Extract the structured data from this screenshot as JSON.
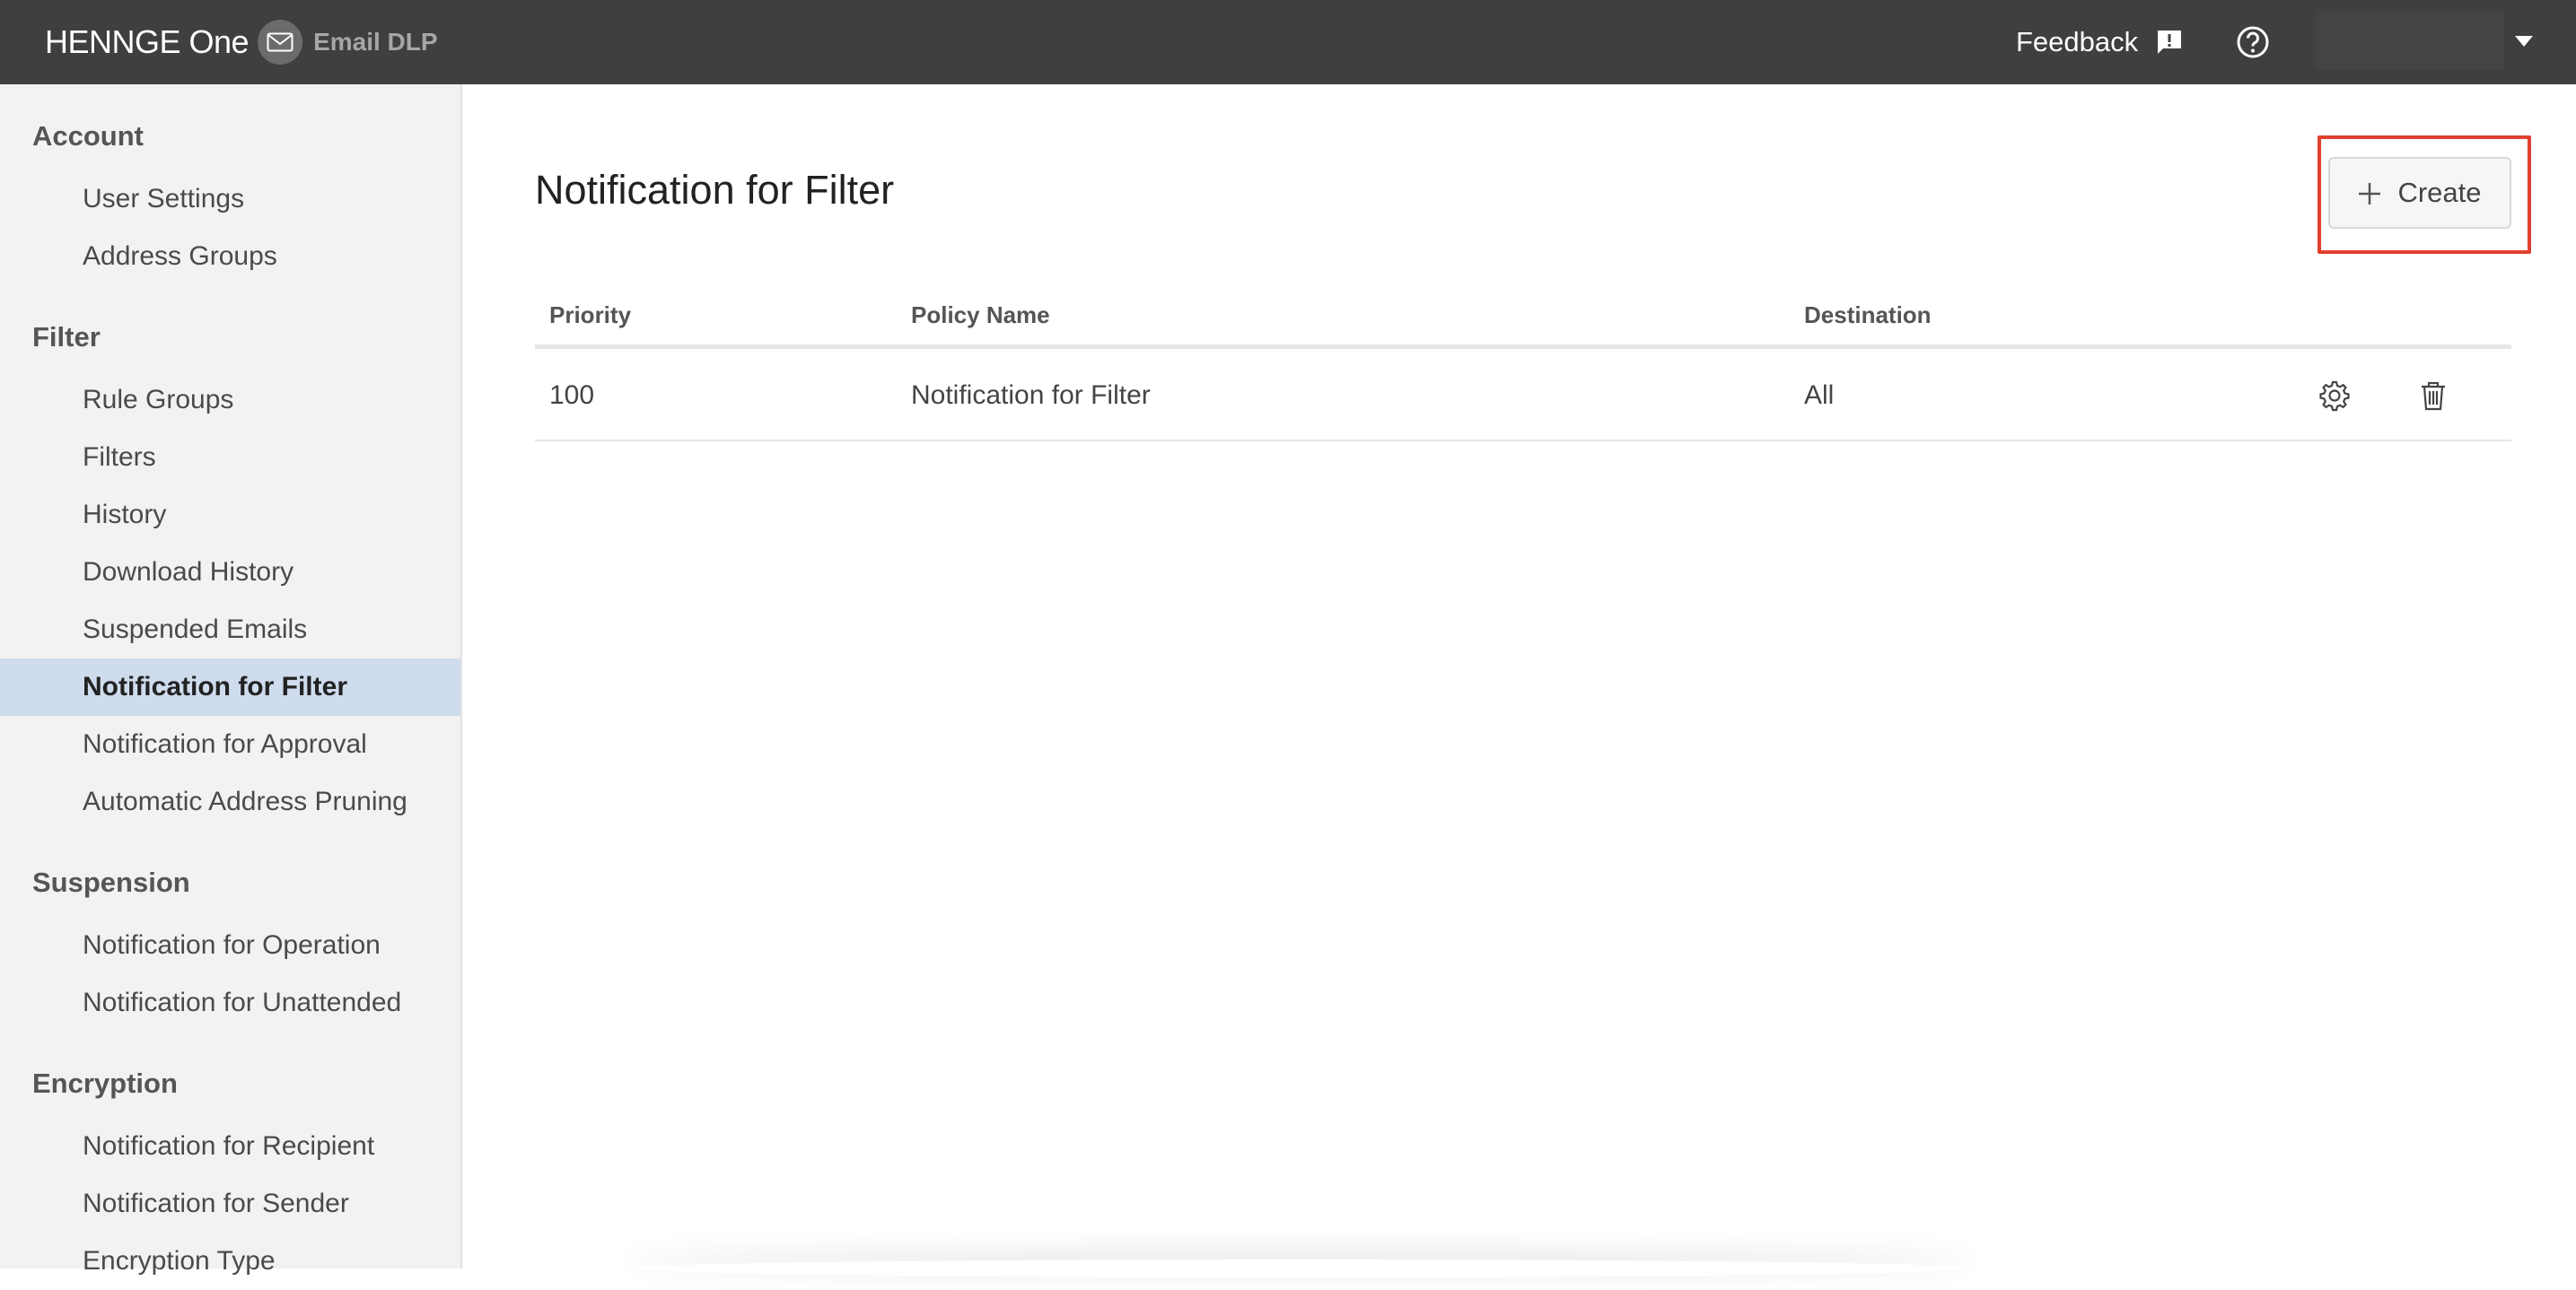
{
  "header": {
    "logo_text": "HENNGE One",
    "product_name": "Email DLP",
    "feedback_label": "Feedback",
    "icons": [
      "mail-icon",
      "feedback-icon",
      "help-icon",
      "caret-down-icon"
    ]
  },
  "sidebar": {
    "sections": [
      {
        "title": "Account",
        "items": [
          "User Settings",
          "Address Groups"
        ]
      },
      {
        "title": "Filter",
        "items": [
          "Rule Groups",
          "Filters",
          "History",
          "Download History",
          "Suspended Emails",
          "Notification for Filter",
          "Notification for Approval",
          "Automatic Address Pruning"
        ]
      },
      {
        "title": "Suspension",
        "items": [
          "Notification for Operation",
          "Notification for Unattended"
        ]
      },
      {
        "title": "Encryption",
        "items": [
          "Notification for Recipient",
          "Notification for Sender",
          "Encryption Type"
        ]
      }
    ],
    "active_item": "Notification for Filter"
  },
  "main": {
    "title": "Notification for Filter",
    "create_label": "Create",
    "table": {
      "headers": [
        "Priority",
        "Policy Name",
        "Destination"
      ],
      "rows": [
        {
          "priority": "100",
          "policy_name": "Notification for Filter",
          "destination": "All"
        }
      ]
    }
  },
  "colors": {
    "topbar": "#3f3f3f",
    "sidebar_bg": "#f2f2f2",
    "active_item_bg": "#cfdced",
    "highlight_outline": "#e0402f"
  }
}
